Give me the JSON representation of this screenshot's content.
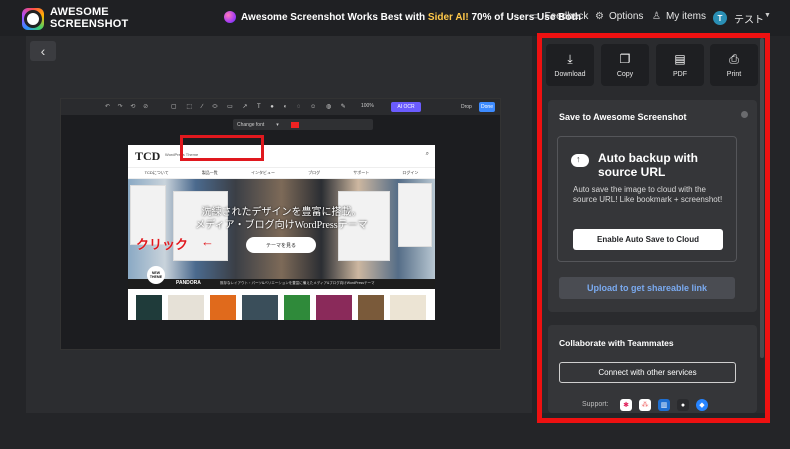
{
  "brand": {
    "line1": "AWESOME",
    "line2": "SCREENSHOT"
  },
  "promo": {
    "prefix": "Awesome Screenshot Works Best with ",
    "highlight": "Sider AI!",
    "suffix": " 70% of Users Use Both"
  },
  "nav": {
    "feedback": "Feedback",
    "options": "Options",
    "my_items": "My items",
    "avatar_letter": "T",
    "user_name": "テスト"
  },
  "editor": {
    "zoom": "100%",
    "ai_label": "AI OCR",
    "drop_label": "Drop",
    "done_label": "Done",
    "font_label": "Change font"
  },
  "webpage": {
    "logo": "TCD",
    "tagline": "WordPress Theme",
    "nav_items": [
      "TCDについて",
      "製品一覧",
      "インタビュー",
      "ブログ",
      "サポート",
      "ログイン"
    ],
    "hero_line1": "洗練されたデザインを豊富に搭載。",
    "hero_line2": "メディア・ブログ向けWordPressテーマ",
    "hero_button": "テーマを見る",
    "badge": "NEW THEME",
    "brand": "PANDORA",
    "strip_text": "既存なレイアウト・パーツ&バリエーションを豊富に備えたメディア&ブログ向けWordPressテーマ"
  },
  "annotation": {
    "text": "クリック",
    "arrow": "←"
  },
  "panel": {
    "actions": [
      {
        "icon": "download-icon",
        "label": "Download"
      },
      {
        "icon": "copy-icon",
        "label": "Copy"
      },
      {
        "icon": "pdf-icon",
        "label": "PDF"
      },
      {
        "icon": "print-icon",
        "label": "Print"
      }
    ],
    "save_title": "Save to Awesome Screenshot",
    "backup_title": "Auto backup with source URL",
    "backup_desc": "Auto save the image to cloud with the source URL! Like bookmark + screenshot!",
    "enable_button": "Enable Auto Save to Cloud",
    "upload_button": "Upload to get shareable link",
    "collab_title": "Collaborate with Teammates",
    "connect_button": "Connect with other services",
    "support_label": "Support:",
    "services": [
      "slack-icon",
      "asana-icon",
      "trello-icon",
      "github-icon",
      "jira-icon"
    ]
  },
  "colors": {
    "accent": "#ee1111",
    "link": "#7aaaf0",
    "promo_highlight": "#ffc84a",
    "background": "#242528"
  }
}
